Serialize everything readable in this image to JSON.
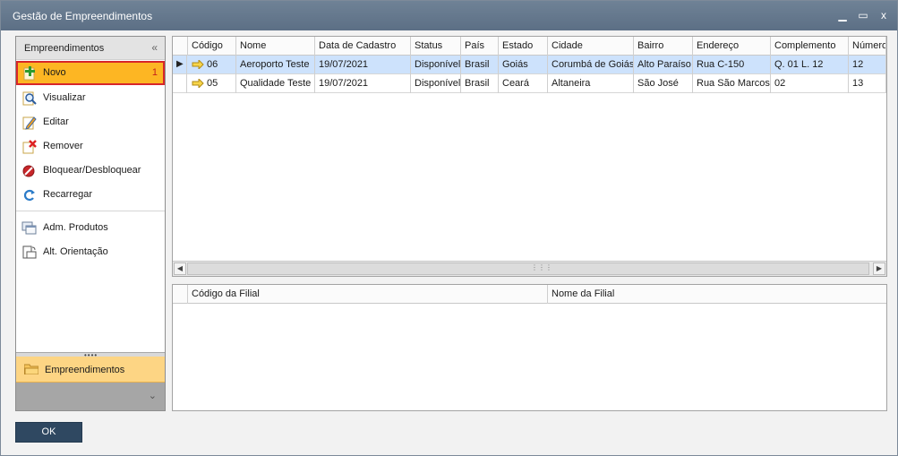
{
  "window": {
    "title": "Gestão de Empreendimentos",
    "minimize": "▁",
    "maximize": "▭",
    "close": "x"
  },
  "sidebar": {
    "header": "Empreendimentos",
    "collapse_glyph": "«",
    "items": [
      {
        "label": "Novo",
        "icon": "add-document-icon",
        "badge": "1"
      },
      {
        "label": "Visualizar",
        "icon": "search-document-icon"
      },
      {
        "label": "Editar",
        "icon": "edit-document-icon"
      },
      {
        "label": "Remover",
        "icon": "remove-document-icon"
      },
      {
        "label": "Bloquear/Desbloquear",
        "icon": "block-icon"
      },
      {
        "label": "Recarregar",
        "icon": "refresh-icon"
      },
      {
        "label": "Adm. Produtos",
        "icon": "windows-icon"
      },
      {
        "label": "Alt. Orientação",
        "icon": "orientation-icon"
      }
    ],
    "group": {
      "label": "Empreendimentos",
      "icon": "folder-icon"
    },
    "footer_chevron": "⌄"
  },
  "grid": {
    "columns": [
      "Código",
      "Nome",
      "Data de Cadastro",
      "Status",
      "País",
      "Estado",
      "Cidade",
      "Bairro",
      "Endereço",
      "Complemento",
      "Número"
    ],
    "rows": [
      [
        "06",
        "Aeroporto Teste",
        "19/07/2021",
        "Disponível",
        "Brasil",
        "Goiás",
        "Corumbá de Goiás",
        "Alto Paraíso",
        "Rua C-150",
        "Q. 01 L. 12",
        "12"
      ],
      [
        "05",
        "Qualidade Teste",
        "19/07/2021",
        "Disponível",
        "Brasil",
        "Ceará",
        "Altaneira",
        "São José",
        "Rua São Marcos",
        "02",
        "13"
      ]
    ],
    "selected_row": 0
  },
  "detail_grid": {
    "columns": [
      "Código da Filial",
      "Nome da Filial"
    ]
  },
  "buttons": {
    "ok": "OK"
  },
  "colors": {
    "titlebar": "#62768b",
    "active_item": "#fdb623",
    "active_border": "#d7262a",
    "selected_row": "#cde2fc",
    "ok_button": "#2f4861"
  }
}
